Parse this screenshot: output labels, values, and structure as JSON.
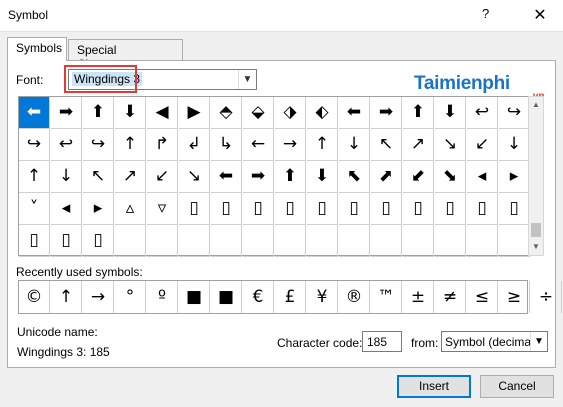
{
  "window": {
    "title": "Symbol",
    "help": "?",
    "close": "✕"
  },
  "tabs": [
    {
      "label": "Symbols",
      "access": "S"
    },
    {
      "label": "Special Characters",
      "access": "P"
    }
  ],
  "font": {
    "label": "Font:",
    "value": "Wingdings 3"
  },
  "watermark": {
    "brand": "Taimienphi",
    "tld": ".vn"
  },
  "symbols": [
    [
      "⬅",
      "➡",
      "⬆",
      "⬇",
      "◀",
      "▶",
      "⬘",
      "⬙",
      "⬗",
      "⬖",
      "⬅",
      "➡",
      "⬆",
      "⬇",
      "↩",
      "↪"
    ],
    [
      "↪",
      "↩",
      "↪",
      "↑",
      "↱",
      "↲",
      "↳",
      "←",
      "→",
      "↑",
      "↓",
      "↖",
      "↗",
      "↘",
      "↙",
      "↓"
    ],
    [
      "↑",
      "↓",
      "↖",
      "↗",
      "↙",
      "↘",
      "⬅",
      "➡",
      "⬆",
      "⬇",
      "⬉",
      "⬈",
      "⬋",
      "⬊",
      "◂",
      "▸"
    ],
    [
      "˅",
      "◂",
      "▸",
      "▵",
      "▿",
      "▯",
      "▯",
      "▯",
      "▯",
      "▯",
      "▯",
      "▯",
      "▯",
      "▯",
      "▯",
      "▯"
    ],
    [
      "▯",
      "▯",
      "▯",
      "",
      "",
      "",
      "",
      "",
      "",
      "",
      "",
      "",
      "",
      "",
      "",
      ""
    ]
  ],
  "recent": {
    "label": "Recently used symbols:",
    "items": [
      "©",
      "↑",
      "→",
      "°",
      "º",
      "■",
      "■",
      "€",
      "£",
      "¥",
      "®",
      "™",
      "±",
      "≠",
      "≤",
      "≥",
      "÷"
    ]
  },
  "unicode": {
    "label": "Unicode name:",
    "value": "Wingdings 3: 185"
  },
  "charcode": {
    "label": "Character code:",
    "value": "185"
  },
  "from": {
    "label": "from:",
    "value": "Symbol (decimal)"
  },
  "buttons": {
    "insert": "Insert",
    "cancel": "Cancel"
  }
}
